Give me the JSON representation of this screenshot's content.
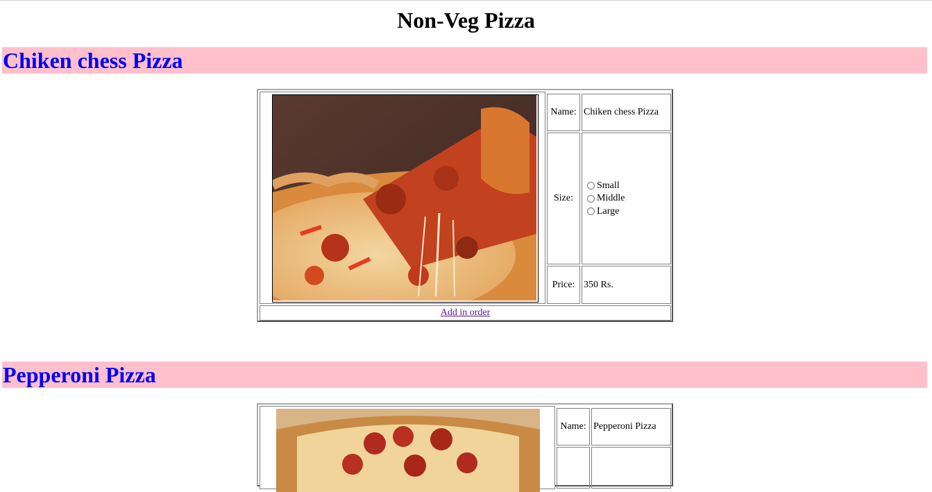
{
  "page": {
    "title": "Non-Veg Pizza"
  },
  "products": [
    {
      "heading": "Chiken chess Pizza",
      "image_alt": "chicken cheese pizza slice photo",
      "name_label": "Name:",
      "name_value": "Chiken chess Pizza",
      "size_label": "Size:",
      "size_options": [
        "Small",
        "Middle",
        "Large"
      ],
      "price_label": "Price:",
      "price_value": "350 Rs.",
      "order_link": "Add in order"
    },
    {
      "heading": "Pepperoni Pizza",
      "image_alt": "pepperoni pizza photo",
      "name_label": "Name:",
      "name_value": "Pepperoni Pizza"
    }
  ],
  "colors": {
    "section_bg": "#ffc0cb",
    "section_text": "#0000ff",
    "visited_link": "#551a8b"
  }
}
